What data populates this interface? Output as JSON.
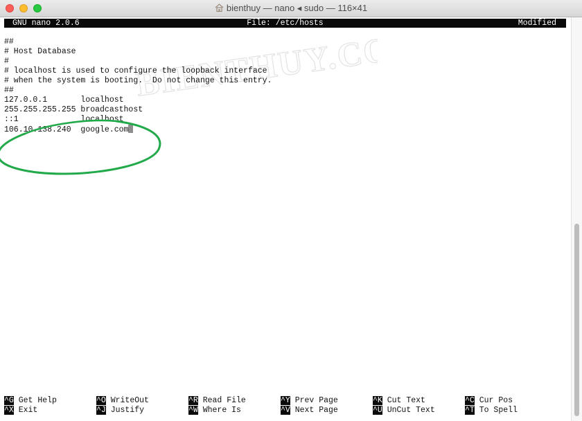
{
  "window": {
    "title": "bienthuy — nano ◂ sudo — 116×41"
  },
  "nano": {
    "version": "GNU nano 2.0.6",
    "file": "File: /etc/hosts",
    "status": "Modified"
  },
  "file_lines": [
    "##",
    "# Host Database",
    "#",
    "# localhost is used to configure the loopback interface",
    "# when the system is booting.  Do not change this entry.",
    "##",
    "127.0.0.1       localhost",
    "255.255.255.255 broadcasthost",
    "::1             localhost",
    "106.10.138.240  google.com"
  ],
  "watermark": "BIENTHUY.COM",
  "shortcuts": [
    [
      {
        "key": "^G",
        "label": "Get Help"
      },
      {
        "key": "^X",
        "label": "Exit"
      }
    ],
    [
      {
        "key": "^O",
        "label": "WriteOut"
      },
      {
        "key": "^J",
        "label": "Justify"
      }
    ],
    [
      {
        "key": "^R",
        "label": "Read File"
      },
      {
        "key": "^W",
        "label": "Where Is"
      }
    ],
    [
      {
        "key": "^Y",
        "label": "Prev Page"
      },
      {
        "key": "^V",
        "label": "Next Page"
      }
    ],
    [
      {
        "key": "^K",
        "label": "Cut Text"
      },
      {
        "key": "^U",
        "label": "UnCut Text"
      }
    ],
    [
      {
        "key": "^C",
        "label": "Cur Pos"
      },
      {
        "key": "^T",
        "label": "To Spell"
      }
    ]
  ],
  "colors": {
    "annotation": "#22a94a",
    "header_bg": "#0a0a0a"
  }
}
